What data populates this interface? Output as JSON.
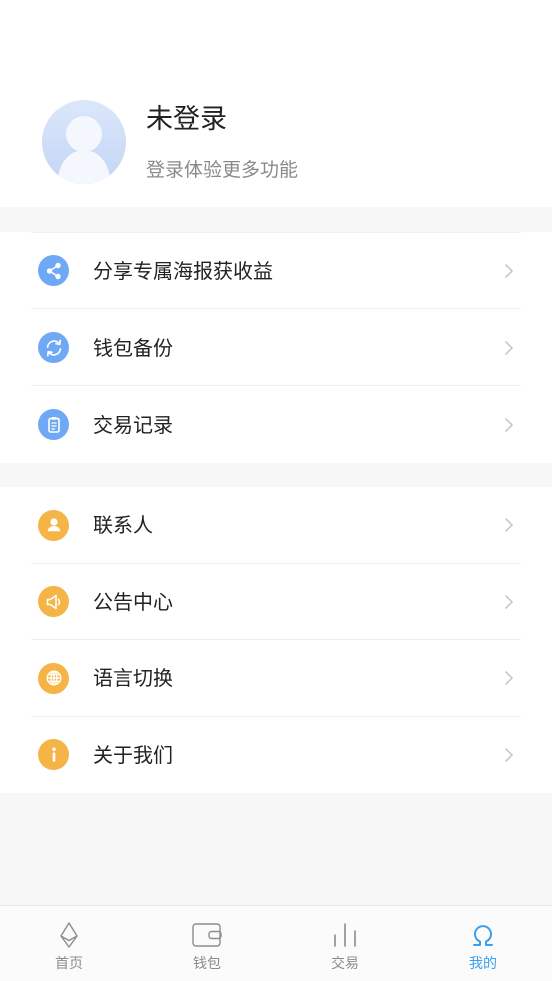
{
  "profile": {
    "name": "未登录",
    "subtitle": "登录体验更多功能",
    "avatar_icon": "avatar-placeholder-icon"
  },
  "menu_groups": [
    {
      "items": [
        {
          "label": "分享专属海报获收益",
          "icon": "share-icon",
          "color": "#6fa9f6"
        },
        {
          "label": "钱包备份",
          "icon": "refresh-icon",
          "color": "#6fa9f6"
        },
        {
          "label": "交易记录",
          "icon": "clipboard-icon",
          "color": "#6fa9f6"
        }
      ]
    },
    {
      "items": [
        {
          "label": "联系人",
          "icon": "person-icon",
          "color": "#f5b446"
        },
        {
          "label": "公告中心",
          "icon": "speaker-icon",
          "color": "#f5b446"
        },
        {
          "label": "语言切换",
          "icon": "globe-icon",
          "color": "#f5b446"
        },
        {
          "label": "关于我们",
          "icon": "info-icon",
          "color": "#f5b446"
        }
      ]
    }
  ],
  "tabbar": {
    "tabs": [
      {
        "label": "首页",
        "icon": "ethereum-icon",
        "active": false
      },
      {
        "label": "钱包",
        "icon": "wallet-icon",
        "active": false
      },
      {
        "label": "交易",
        "icon": "bar-chart-icon",
        "active": false
      },
      {
        "label": "我的",
        "icon": "omega-icon",
        "active": true
      }
    ]
  },
  "colors": {
    "background": "#f7f7f7",
    "primary_text": "#222222",
    "secondary_text": "#8a8a8a",
    "accent": "#3b9ff0",
    "tab_inactive": "#8c8c8c",
    "chevron": "#c8c8c8"
  }
}
